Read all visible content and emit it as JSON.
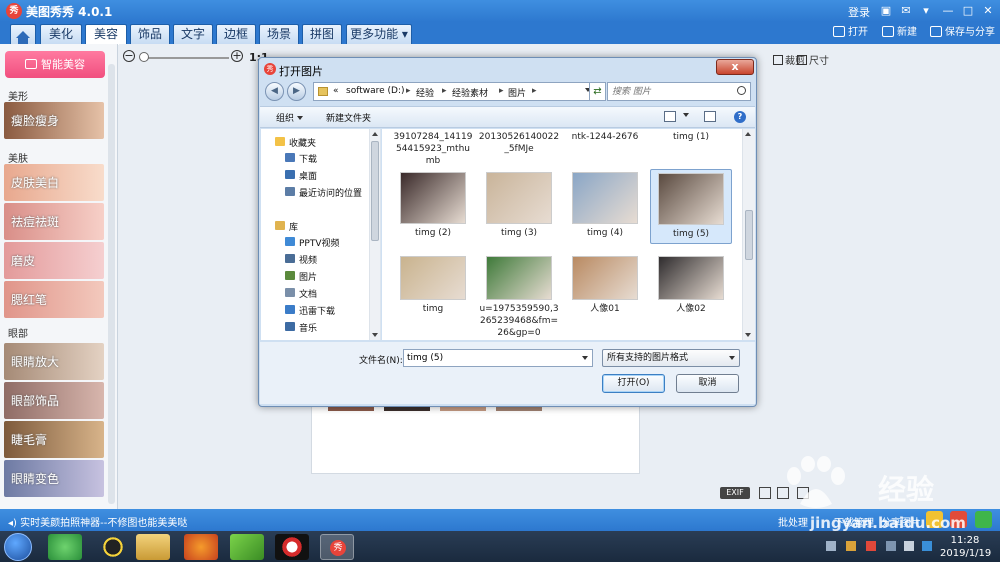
{
  "app": {
    "title": "美图秀秀 4.0.1",
    "logo_text": "秀",
    "login": "登录"
  },
  "tabs": [
    {
      "label": "美化",
      "active": false
    },
    {
      "label": "美容",
      "active": true
    },
    {
      "label": "饰品",
      "active": false
    },
    {
      "label": "文字",
      "active": false
    },
    {
      "label": "边框",
      "active": false
    },
    {
      "label": "场景",
      "active": false
    },
    {
      "label": "拼图",
      "active": false
    },
    {
      "label": "更多功能",
      "active": false
    }
  ],
  "toolbar": {
    "open": "打开",
    "new": "新建",
    "save_share": "保存与分享"
  },
  "sidebar": {
    "smart_button": "智能美容",
    "sections": {
      "shape": "美形",
      "skin": "美肤",
      "eyes": "眼部"
    },
    "features": [
      {
        "label": "瘦脸瘦身"
      },
      {
        "label": "皮肤美白"
      },
      {
        "label": "祛痘祛斑"
      },
      {
        "label": "磨皮"
      },
      {
        "label": "腮红笔"
      },
      {
        "label": "眼睛放大"
      },
      {
        "label": "眼部饰品"
      },
      {
        "label": "睫毛膏"
      },
      {
        "label": "眼睛变色"
      }
    ]
  },
  "canvas": {
    "zoom_label": "1:1",
    "tools": {
      "crop": "裁剪",
      "size": "尺寸"
    },
    "exif": "EXIF"
  },
  "dialog": {
    "title": "打开图片",
    "close": "x",
    "breadcrumbs": [
      "«",
      "software (D:)",
      "经验",
      "经验素材",
      "图片"
    ],
    "search_placeholder": "搜索 图片",
    "organize": "组织",
    "new_folder": "新建文件夹",
    "nav_items": [
      {
        "label": "收藏夹",
        "indent": 0,
        "icon_color": "#f3c247"
      },
      {
        "label": "下载",
        "indent": 1,
        "icon_color": "#4a78b8"
      },
      {
        "label": "桌面",
        "indent": 1,
        "icon_color": "#3a6fb0"
      },
      {
        "label": "最近访问的位置",
        "indent": 1,
        "icon_color": "#5c7da6"
      },
      {
        "label": "库",
        "indent": 0,
        "icon_color": "#e0b34f"
      },
      {
        "label": "PPTV视频",
        "indent": 1,
        "icon_color": "#3f8ad6"
      },
      {
        "label": "视频",
        "indent": 1,
        "icon_color": "#4a6d96"
      },
      {
        "label": "图片",
        "indent": 1,
        "icon_color": "#5b8a3c"
      },
      {
        "label": "文档",
        "indent": 1,
        "icon_color": "#7a8fa9"
      },
      {
        "label": "迅雷下载",
        "indent": 1,
        "icon_color": "#3b7cc8"
      },
      {
        "label": "音乐",
        "indent": 1,
        "icon_color": "#3d6ba3"
      }
    ],
    "files_row0": [
      {
        "name": "39107284_1411954415923_mthumb"
      },
      {
        "name": "20130526140022_5fMJe"
      },
      {
        "name": "ntk-1244-2676"
      },
      {
        "name": "timg (1)"
      }
    ],
    "files": [
      {
        "name": "timg (2)",
        "thumb_color": "#3a2a2a",
        "selected": false
      },
      {
        "name": "timg (3)",
        "thumb_color": "#c9b49a",
        "selected": false
      },
      {
        "name": "timg (4)",
        "thumb_color": "#8aa6c6",
        "selected": false
      },
      {
        "name": "timg (5)",
        "thumb_color": "#5a4a40",
        "selected": true
      },
      {
        "name": "timg",
        "thumb_color": "#c9b38e",
        "selected": false
      },
      {
        "name": "u=1975359590,3265239468&fm=26&gp=0",
        "thumb_color": "#3f7a3a",
        "selected": false
      },
      {
        "name": "人像01",
        "thumb_color": "#b98a62",
        "selected": false
      },
      {
        "name": "人像02",
        "thumb_color": "#2f2c2e",
        "selected": false
      }
    ],
    "filename_label": "文件名(N):",
    "filename_value": "timg (5)",
    "filetype_value": "所有支持的图片格式",
    "open_button": "打开(O)",
    "cancel_button": "取消"
  },
  "status": {
    "tip": "实时美颜拍照神器--不修图也能美美哒",
    "batch": "批处理",
    "download_manager": "下载管理",
    "share_photo": "分享图片"
  },
  "taskbar": {
    "time": "11:28",
    "date": "2019/1/19"
  },
  "watermark": {
    "cn": "经验",
    "url": "jingyan.baidu.com"
  }
}
